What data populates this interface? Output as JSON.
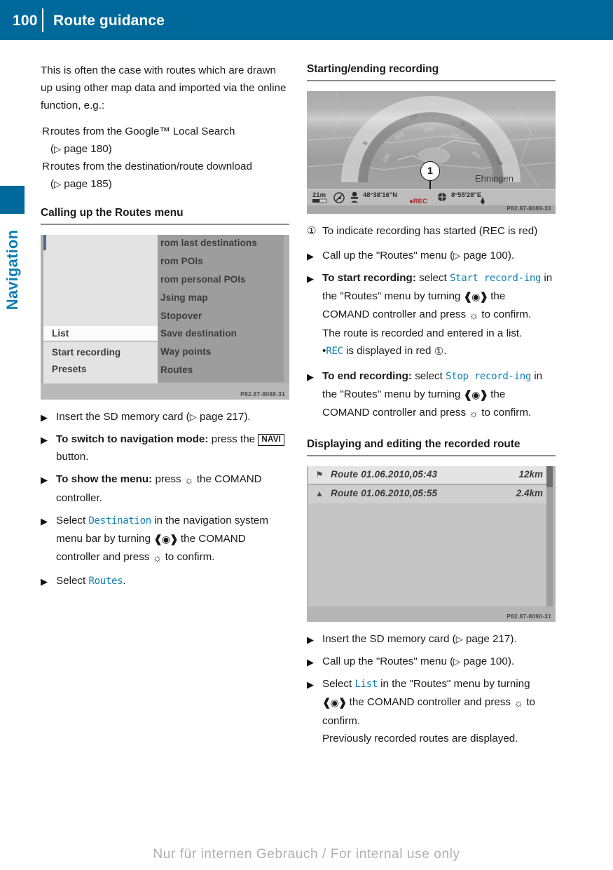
{
  "header": {
    "page_number": "100",
    "chapter_title": "Route guidance"
  },
  "side_tab": {
    "label": "Navigation",
    "accent_color": "#00699c",
    "label_color": "#0b7fb4"
  },
  "left_column": {
    "intro_paragraph": "This is often the case with routes which are drawn up using other map data and imported via the online function, e.g.:",
    "bullets": [
      {
        "marker": "R",
        "text_before": "routes from the Google™ Local Search (",
        "ref": "page 180",
        "text_after": ")"
      },
      {
        "marker": "R",
        "text_before": "routes from the destination/route download (",
        "ref": "page 185",
        "text_after": ")"
      }
    ],
    "section_heading": "Calling up the Routes menu",
    "figure": {
      "name": "routes-menu-screenshot",
      "caption": "P82.87-8088-31",
      "left_pane_items": [
        {
          "label": "List",
          "highlighted": true
        },
        {
          "label": "Start recording",
          "highlighted": false
        },
        {
          "label": "Presets",
          "highlighted": false
        }
      ],
      "right_pane_items": [
        "rom last destinations",
        "rom POIs",
        "rom personal POIs",
        "Jsing map",
        "Stopover",
        "Save destination",
        "Way points",
        "Routes"
      ]
    },
    "steps": [
      {
        "marker": "triangle",
        "parts": [
          {
            "type": "text",
            "value": "Insert the SD memory card ("
          },
          {
            "type": "ref",
            "value": "page 217"
          },
          {
            "type": "text",
            "value": ")."
          }
        ]
      },
      {
        "marker": "triangle",
        "parts": [
          {
            "type": "bold",
            "value": "To switch to navigation mode:"
          },
          {
            "type": "text",
            "value": " press the "
          },
          {
            "type": "hwbutton",
            "value": "NAVI"
          },
          {
            "type": "text",
            "value": " button."
          }
        ]
      },
      {
        "marker": "triangle",
        "parts": [
          {
            "type": "bold",
            "value": "To show the menu:"
          },
          {
            "type": "text",
            "value": " press "
          },
          {
            "type": "press-glyph",
            "value": "press-controller-icon"
          },
          {
            "type": "text",
            "value": " the COMAND controller."
          }
        ]
      },
      {
        "marker": "triangle",
        "parts": [
          {
            "type": "text",
            "value": "Select "
          },
          {
            "type": "mono",
            "value": "Destination"
          },
          {
            "type": "text",
            "value": " in the navigation system menu bar by turning "
          },
          {
            "type": "turn-glyph",
            "value": "turn-controller-icon"
          },
          {
            "type": "text",
            "value": " the COMAND controller and press "
          },
          {
            "type": "press-glyph",
            "value": "press-controller-icon"
          },
          {
            "type": "text",
            "value": " to confirm."
          }
        ]
      },
      {
        "marker": "triangle",
        "parts": [
          {
            "type": "text",
            "value": "Select "
          },
          {
            "type": "mono",
            "value": "Routes"
          },
          {
            "type": "text",
            "value": "."
          }
        ]
      }
    ]
  },
  "right_column": {
    "section_heading_1": "Starting/ending recording",
    "figure_compass": {
      "name": "compass-navigation-screenshot",
      "caption": "P82.87-8089-31",
      "scale": "21m",
      "latitude": "48°38'16\"N",
      "longitude": "8°55'28\"E",
      "rec_indicator": "REC",
      "place_name": "Ehningen",
      "callout_number": "1",
      "compass_marks": [
        "S",
        "SW",
        "W",
        "NW",
        "210",
        "240",
        "270",
        "300",
        "330"
      ]
    },
    "legend": {
      "number": "1",
      "text": "To indicate recording has started (REC is red)"
    },
    "steps_recording": [
      {
        "marker": "triangle",
        "parts": [
          {
            "type": "text",
            "value": "Call up the \"Routes\" menu ("
          },
          {
            "type": "ref",
            "value": "page 100"
          },
          {
            "type": "text",
            "value": ")."
          }
        ]
      },
      {
        "marker": "triangle",
        "parts": [
          {
            "type": "bold",
            "value": "To start recording:"
          },
          {
            "type": "text",
            "value": " select "
          },
          {
            "type": "mono",
            "value": "Start record-"
          },
          {
            "type": "mono-break",
            "value": "ing"
          },
          {
            "type": "text",
            "value": " in the \"Routes\" menu by turning "
          },
          {
            "type": "turn-glyph",
            "value": "turn-controller-icon"
          },
          {
            "type": "text",
            "value": " the COMAND controller and press "
          },
          {
            "type": "press-glyph",
            "value": "press-controller-icon"
          },
          {
            "type": "text",
            "value": " to confirm."
          }
        ],
        "result_lines": [
          "The route is recorded and entered in a list.",
          "REC is displayed in red 1."
        ]
      },
      {
        "marker": "triangle",
        "parts": [
          {
            "type": "bold",
            "value": "To end recording:"
          },
          {
            "type": "text",
            "value": " select "
          },
          {
            "type": "mono",
            "value": "Stop record-"
          },
          {
            "type": "mono-break",
            "value": "ing"
          },
          {
            "type": "text",
            "value": " in the \"Routes\" menu by turning "
          },
          {
            "type": "turn-glyph",
            "value": "turn-controller-icon"
          },
          {
            "type": "text",
            "value": " the COMAND controller and press "
          },
          {
            "type": "press-glyph",
            "value": "press-controller-icon"
          },
          {
            "type": "text",
            "value": " to confirm."
          }
        ]
      }
    ],
    "section_heading_2": "Displaying and editing the recorded route",
    "figure_route_list": {
      "name": "recorded-routes-list-screenshot",
      "caption": "P82.87-8090-31",
      "rows": [
        {
          "icon": "flag-icon",
          "name": "Route 01.06.2010,05:43",
          "distance": "12km",
          "selected": true
        },
        {
          "icon": "marker-icon",
          "name": "Route 01.06.2010,05:55",
          "distance": "2.4km",
          "selected": false
        }
      ]
    },
    "steps_list": [
      {
        "marker": "triangle",
        "parts": [
          {
            "type": "text",
            "value": "Insert the SD memory card ("
          },
          {
            "type": "ref",
            "value": "page 217"
          },
          {
            "type": "text",
            "value": ")."
          }
        ]
      },
      {
        "marker": "triangle",
        "parts": [
          {
            "type": "text",
            "value": "Call up the \"Routes\" menu ("
          },
          {
            "type": "ref",
            "value": "page 100"
          },
          {
            "type": "text",
            "value": ")."
          }
        ]
      },
      {
        "marker": "triangle",
        "parts": [
          {
            "type": "text",
            "value": "Select "
          },
          {
            "type": "mono",
            "value": "List"
          },
          {
            "type": "text",
            "value": " in the \"Routes\" menu by turning "
          },
          {
            "type": "turn-glyph",
            "value": "turn-controller-icon"
          },
          {
            "type": "text",
            "value": " the COMAND controller and press "
          },
          {
            "type": "press-glyph",
            "value": "press-controller-icon"
          },
          {
            "type": "text",
            "value": " to confirm."
          }
        ],
        "result_lines": [
          "Previously recorded routes are displayed."
        ]
      }
    ]
  },
  "footer": {
    "watermark": "Nur für internen Gebrauch / For internal use only"
  }
}
